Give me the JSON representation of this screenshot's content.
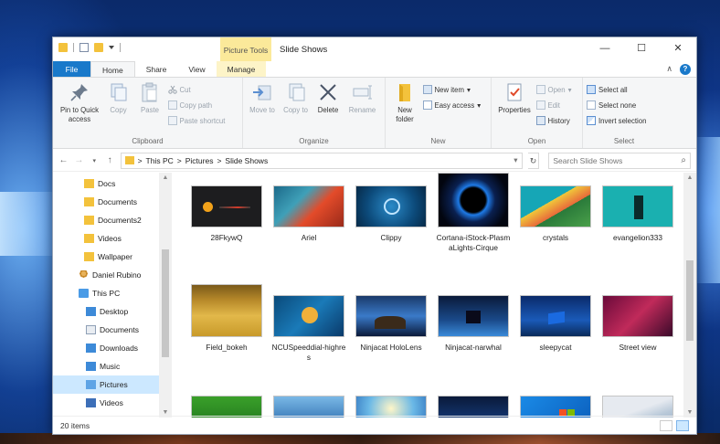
{
  "window": {
    "title": "Slide Shows",
    "context_tab_header": "Picture Tools",
    "controls": {
      "minimize": "—",
      "maximize": "☐",
      "close": "✕"
    }
  },
  "tabs": [
    {
      "label": "File"
    },
    {
      "label": "Home"
    },
    {
      "label": "Share"
    },
    {
      "label": "View"
    },
    {
      "label": "Manage"
    }
  ],
  "ribbon": {
    "clipboard": {
      "label": "Clipboard",
      "pin": "Pin to Quick access",
      "copy": "Copy",
      "paste": "Paste",
      "cut": "Cut",
      "copy_path": "Copy path",
      "paste_shortcut": "Paste shortcut"
    },
    "organize": {
      "label": "Organize",
      "move_to": "Move to",
      "copy_to": "Copy to",
      "delete": "Delete",
      "rename": "Rename"
    },
    "new": {
      "label": "New",
      "new_folder": "New folder",
      "new_item": "New item",
      "easy_access": "Easy access"
    },
    "open": {
      "label": "Open",
      "properties": "Properties",
      "open": "Open",
      "edit": "Edit",
      "history": "History"
    },
    "select": {
      "label": "Select",
      "select_all": "Select all",
      "select_none": "Select none",
      "invert_selection": "Invert selection"
    }
  },
  "address": {
    "path": [
      "This PC",
      "Pictures",
      "Slide Shows"
    ],
    "separator": ">",
    "search_placeholder": "Search Slide Shows"
  },
  "nav": [
    {
      "label": "Docs",
      "icon": "folder-icon"
    },
    {
      "label": "Documents",
      "icon": "folder-icon"
    },
    {
      "label": "Documents2",
      "icon": "folder-icon"
    },
    {
      "label": "Videos",
      "icon": "folder-icon"
    },
    {
      "label": "Wallpaper",
      "icon": "folder-icon"
    },
    {
      "label": "Daniel Rubino",
      "icon": "user-icon"
    },
    {
      "label": "This PC",
      "icon": "pc-icon"
    },
    {
      "label": "Desktop",
      "icon": "desktop-icon"
    },
    {
      "label": "Documents",
      "icon": "documents-icon"
    },
    {
      "label": "Downloads",
      "icon": "downloads-icon"
    },
    {
      "label": "Music",
      "icon": "music-icon"
    },
    {
      "label": "Pictures",
      "icon": "pictures-icon"
    },
    {
      "label": "Videos",
      "icon": "videos-icon"
    }
  ],
  "files": [
    {
      "name": "28FkywQ"
    },
    {
      "name": "Ariel"
    },
    {
      "name": "Clippy"
    },
    {
      "name": "Cortana-iStock-PlasmaLights-Cirque"
    },
    {
      "name": "crystals"
    },
    {
      "name": "evangelion333"
    },
    {
      "name": "Field_bokeh"
    },
    {
      "name": "NCUSpeeddial-highres"
    },
    {
      "name": "Ninjacat HoloLens"
    },
    {
      "name": "Ninjacat-narwhal"
    },
    {
      "name": "sleepycat"
    },
    {
      "name": "Street view"
    },
    {
      "name": ""
    },
    {
      "name": ""
    },
    {
      "name": ""
    },
    {
      "name": ""
    },
    {
      "name": ""
    },
    {
      "name": ""
    }
  ],
  "status": {
    "item_count": "20 items"
  }
}
